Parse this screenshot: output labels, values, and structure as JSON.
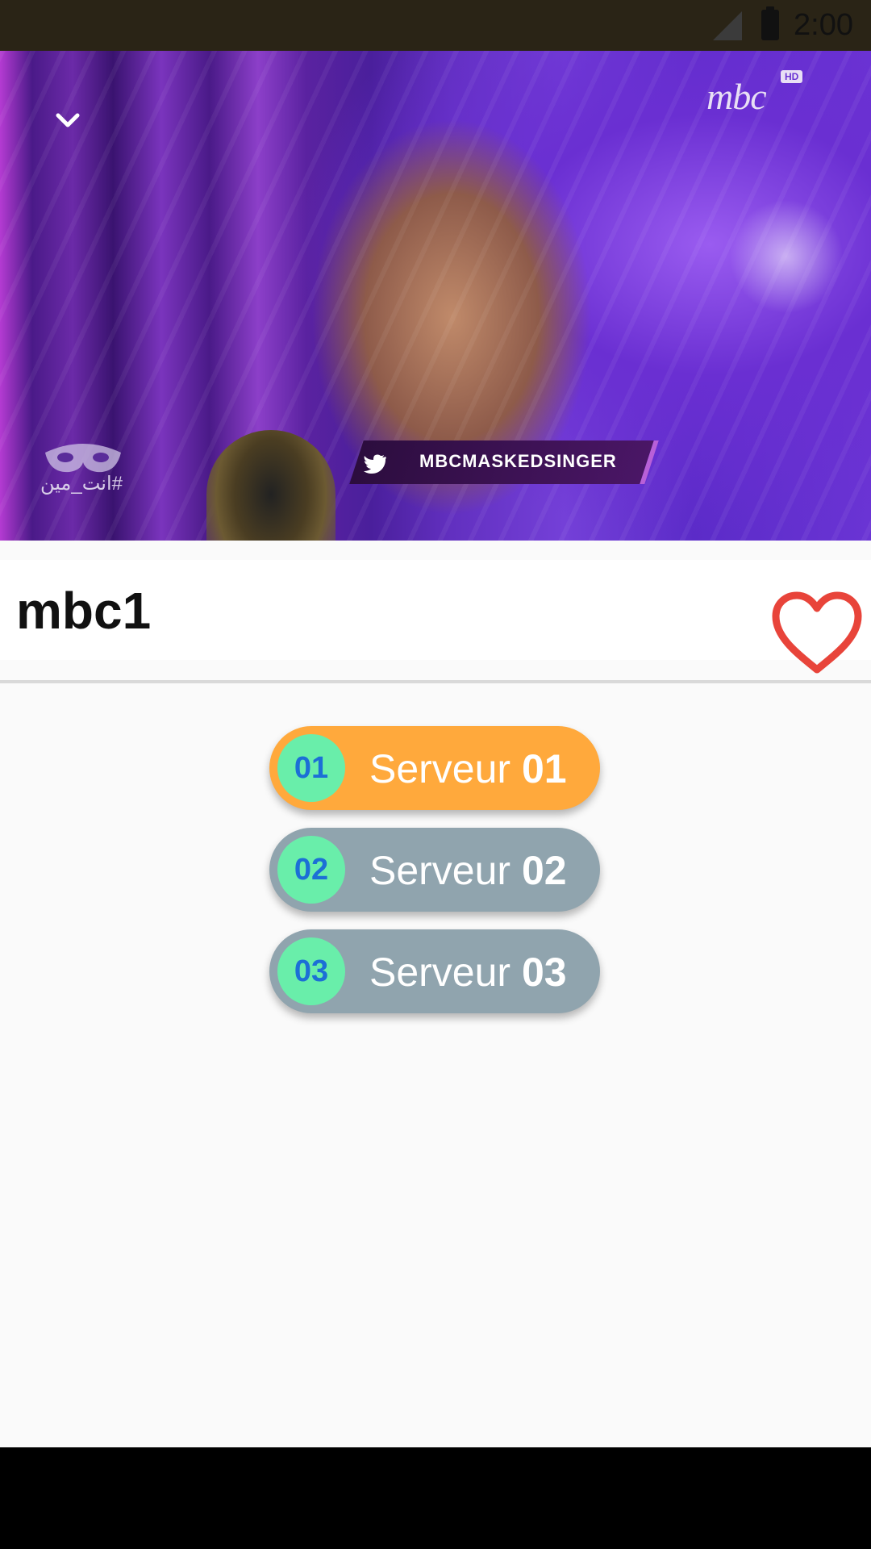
{
  "status_bar": {
    "time": "2:00"
  },
  "player": {
    "channel_logo": "mbc",
    "hd_badge": "HD",
    "show_hashtag": "#انت_مين",
    "twitter_handle": "MBCMASKEDSINGER"
  },
  "channel": {
    "title": "mbc1"
  },
  "servers": [
    {
      "badge": "01",
      "word": "Serveur",
      "number": "01",
      "color": "#ffa93c",
      "selected": true
    },
    {
      "badge": "02",
      "word": "Serveur",
      "number": "02",
      "color": "#90a4ae",
      "selected": false
    },
    {
      "badge": "03",
      "word": "Serveur",
      "number": "03",
      "color": "#90a4ae",
      "selected": false
    }
  ],
  "colors": {
    "selected": "#ffa93c",
    "unselected": "#90a4ae",
    "badge_bg": "#69eeaa",
    "badge_text": "#1c6fd6",
    "favorite": "#e8443a"
  },
  "icons": {
    "collapse": "chevron-down-icon",
    "favorite": "heart-outline-icon",
    "twitter": "twitter-icon",
    "signal": "signal-icon",
    "battery": "battery-icon"
  }
}
